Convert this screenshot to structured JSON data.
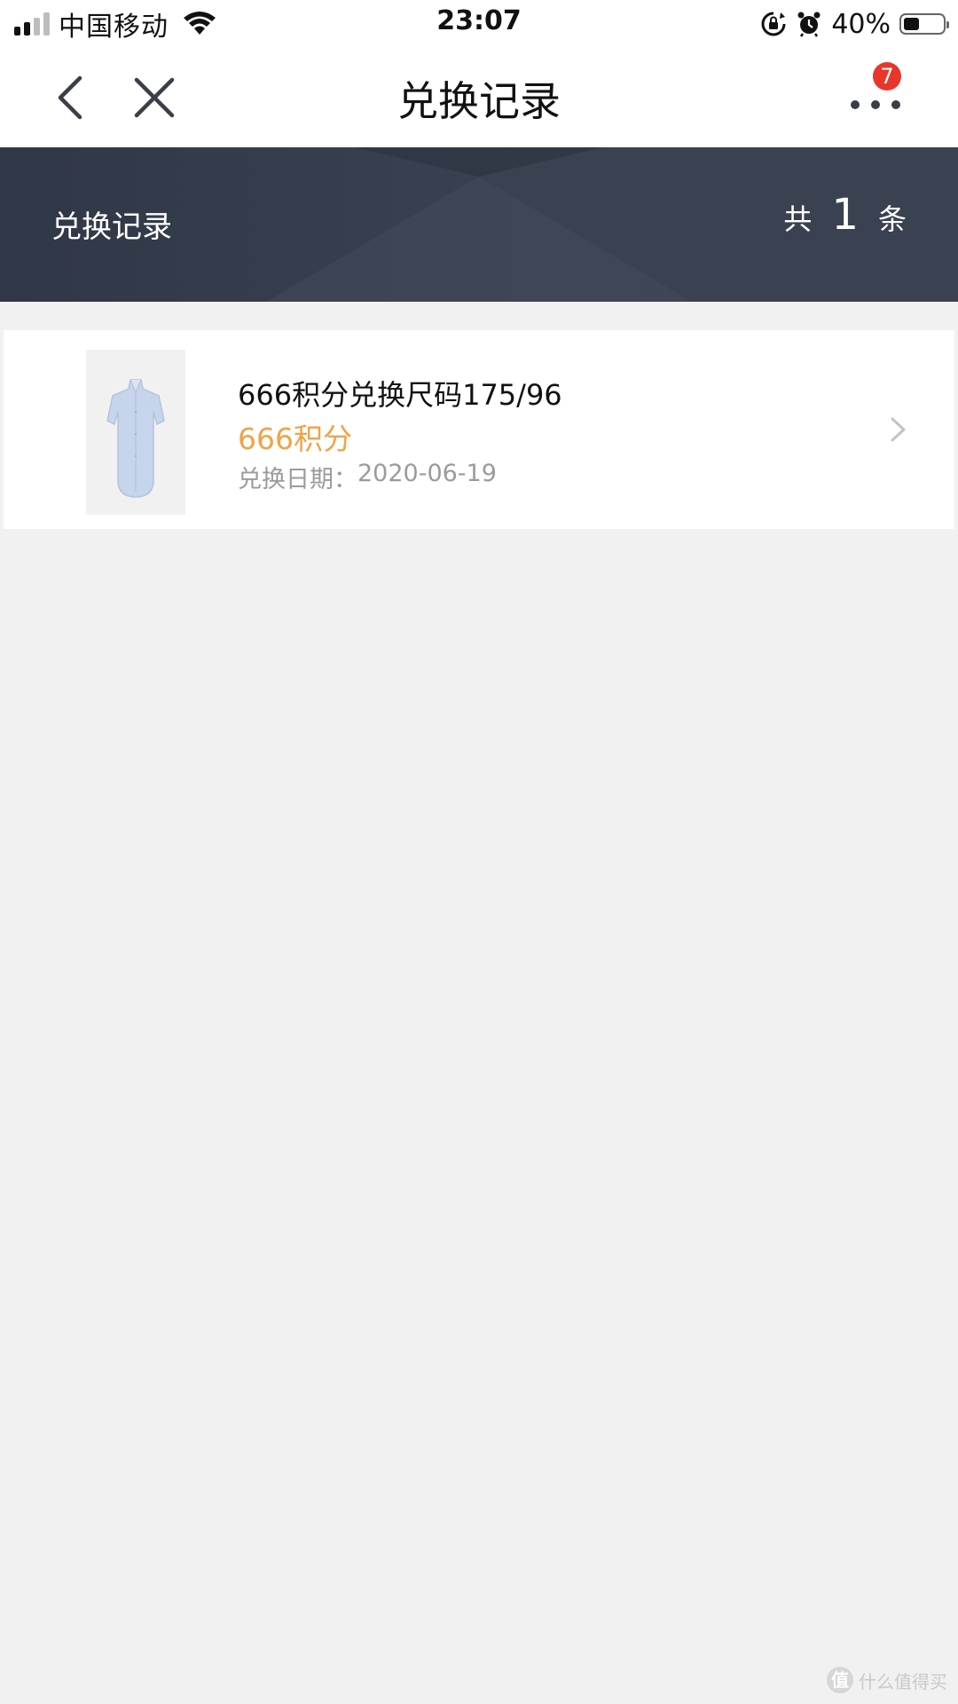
{
  "status_bar": {
    "carrier": "中国移动",
    "time": "23:07",
    "battery_percent": "40%",
    "battery_level": 0.4,
    "icons": [
      "signal-icon",
      "wifi-icon",
      "rotation-lock-icon",
      "alarm-icon",
      "battery-icon"
    ]
  },
  "nav": {
    "title": "兑换记录",
    "back_icon": "chevron-left-icon",
    "close_icon": "close-icon",
    "more_icon": "more-icon",
    "badge": "7"
  },
  "banner": {
    "title": "兑换记录",
    "count_prefix": "共",
    "count": "1",
    "count_suffix": "条"
  },
  "records": [
    {
      "title": "666积分兑换尺码175/96",
      "points": "666积分",
      "date_label": "兑换日期：",
      "date": "2020-06-19",
      "image_icon": "shirt-image"
    }
  ],
  "colors": {
    "points": "#f0a347",
    "banner": "#353c4b",
    "badge": "#e8362b",
    "background": "#f1f1f1"
  },
  "watermark": {
    "logo": "值",
    "text": "什么值得买"
  }
}
